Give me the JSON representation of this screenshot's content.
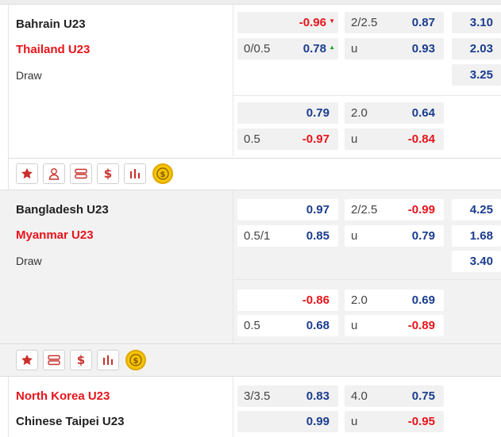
{
  "colors": {
    "favorite": "#e8141b",
    "odds_blue": "#1a3d8f",
    "odds_red": "#e8141b",
    "arrow_up": "#1ea12f",
    "coin": "#f5c400"
  },
  "matches": [
    {
      "home": "Bahrain U23",
      "away": "Thailand U23",
      "draw_label": "Draw",
      "ft": {
        "hcp_top": "",
        "hcp_top_odd": "-0.96",
        "hcp_top_arrow": "▼",
        "hcp_bottom": "0/0.5",
        "hcp_bottom_odd": "0.78",
        "hcp_bottom_arrow": "▲",
        "ou_line": "2/2.5",
        "ou_over": "0.87",
        "ou_u": "u",
        "ou_under": "0.93",
        "x12": [
          "3.10",
          "2.03",
          "3.25"
        ]
      },
      "ht": {
        "hcp_top": "",
        "hcp_top_odd": "0.79",
        "hcp_bottom": "0.5",
        "hcp_bottom_odd": "-0.97",
        "ou_line": "2.0",
        "ou_over": "0.64",
        "ou_u": "u",
        "ou_under": "-0.84"
      },
      "icons": [
        "star-icon",
        "person-icon",
        "ticket-icon",
        "dollar-icon",
        "stats-icon",
        "coin-icon"
      ]
    },
    {
      "home": "Bangladesh U23",
      "away": "Myanmar U23",
      "draw_label": "Draw",
      "ft": {
        "hcp_top": "",
        "hcp_top_odd": "0.97",
        "hcp_bottom": "0.5/1",
        "hcp_bottom_odd": "0.85",
        "ou_line": "2/2.5",
        "ou_over": "-0.99",
        "ou_u": "u",
        "ou_under": "0.79",
        "x12": [
          "4.25",
          "1.68",
          "3.40"
        ]
      },
      "ht": {
        "hcp_top": "",
        "hcp_top_odd": "-0.86",
        "hcp_bottom": "0.5",
        "hcp_bottom_odd": "0.68",
        "ou_line": "2.0",
        "ou_over": "0.69",
        "ou_u": "u",
        "ou_under": "-0.89"
      },
      "icons": [
        "star-icon",
        "ticket-icon",
        "dollar-icon",
        "stats-icon",
        "coin-icon"
      ]
    },
    {
      "home": "North Korea U23",
      "away": "Chinese Taipei U23",
      "ft": {
        "hcp_top": "3/3.5",
        "hcp_top_odd": "0.83",
        "hcp_bottom": "",
        "hcp_bottom_odd": "0.99",
        "ou_line": "4.0",
        "ou_over": "0.75",
        "ou_u": "u",
        "ou_under": "-0.95"
      }
    }
  ]
}
